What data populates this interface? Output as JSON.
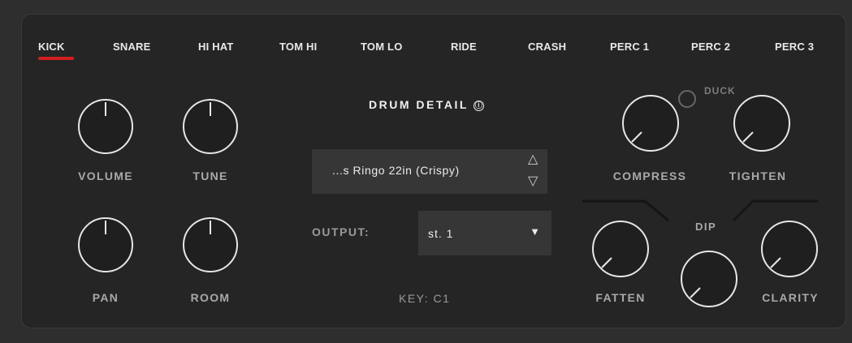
{
  "tabs": [
    "KICK",
    "SNARE",
    "HI HAT",
    "TOM HI",
    "TOM LO",
    "RIDE",
    "CRASH",
    "PERC 1",
    "PERC 2",
    "PERC 3"
  ],
  "active_tab": "KICK",
  "accent_color": "#d21f1f",
  "knobs": {
    "volume": {
      "label": "VOLUME"
    },
    "tune": {
      "label": "TUNE"
    },
    "pan": {
      "label": "PAN"
    },
    "room": {
      "label": "ROOM"
    },
    "compress": {
      "label": "COMPRESS"
    },
    "tighten": {
      "label": "TIGHTEN"
    },
    "fatten": {
      "label": "FATTEN"
    },
    "dip": {
      "label": "DIP"
    },
    "clarity": {
      "label": "CLARITY"
    }
  },
  "drum_detail": {
    "title": "DRUM DETAIL",
    "info_icon": "ⓘ",
    "sample_name": "...s Ringo 22in (Crispy)",
    "up_arrow": "△",
    "down_arrow": "▽"
  },
  "output": {
    "label": "OUTPUT:",
    "value": "st. 1",
    "dropdown_icon": "▼"
  },
  "key_text": "KEY: C1",
  "duck": {
    "label": "DUCK"
  }
}
